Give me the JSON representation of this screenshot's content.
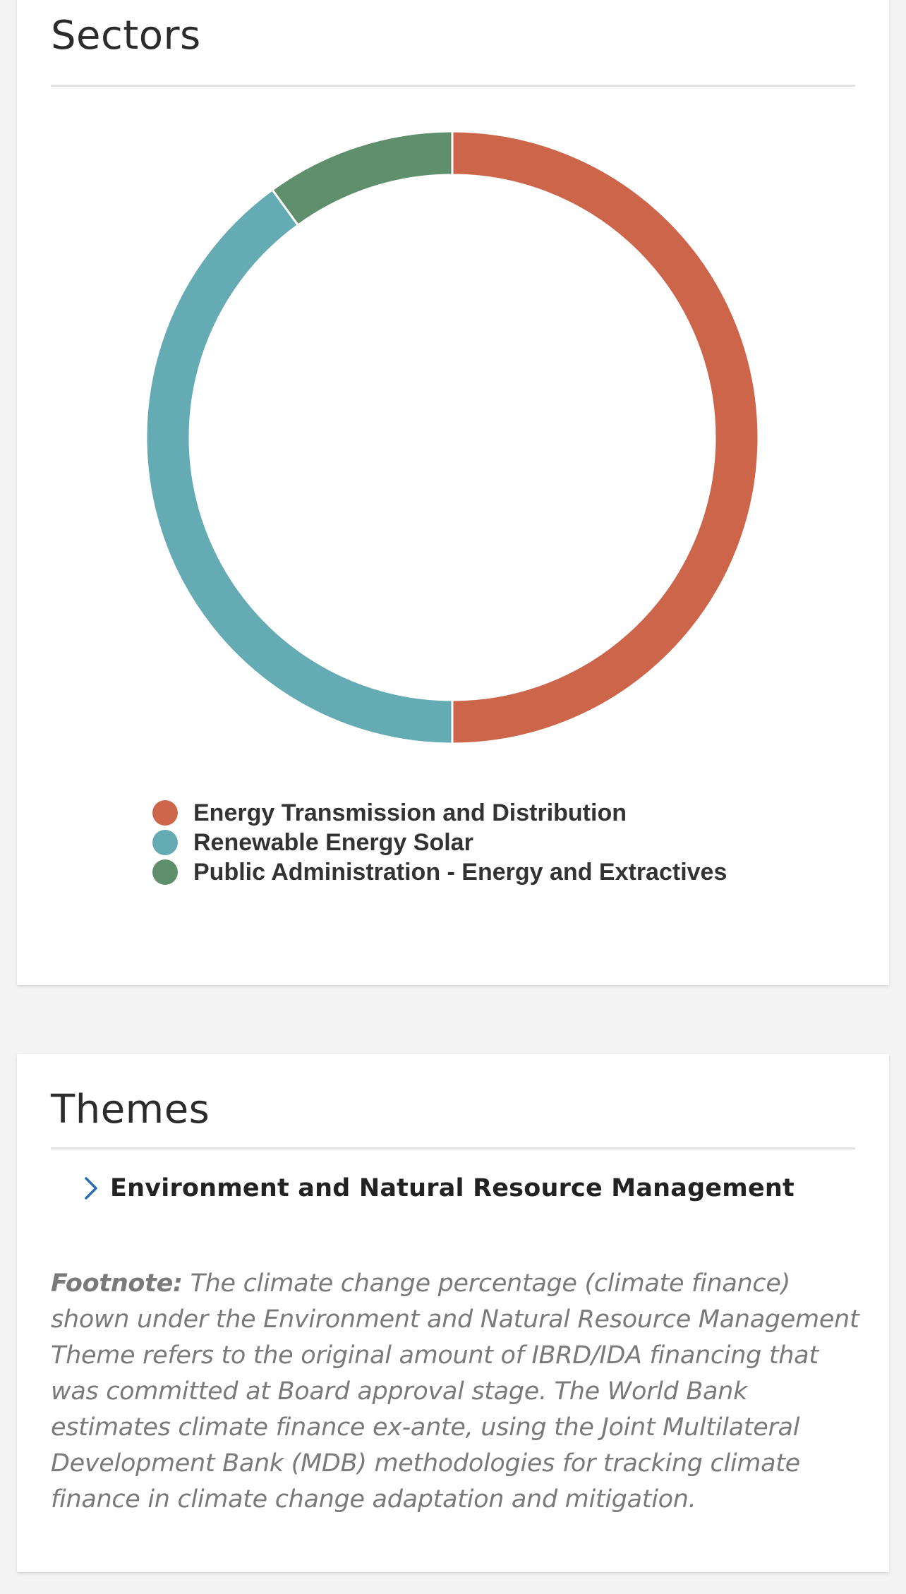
{
  "sectors": {
    "title": "Sectors"
  },
  "chart_data": {
    "type": "pie",
    "donut": true,
    "title": "Sectors",
    "categories": [
      "Energy Transmission and Distribution",
      "Renewable Energy Solar",
      "Public Administration - Energy and Extractives"
    ],
    "values": [
      50,
      40,
      10
    ],
    "unit": "%",
    "colors": [
      "#cd654b",
      "#64abb4",
      "#5f8f6c"
    ],
    "legend_position": "bottom"
  },
  "themes": {
    "title": "Themes",
    "items": [
      {
        "label": "Environment and Natural Resource Management",
        "icon": "chevron-right-icon"
      }
    ],
    "footnote": {
      "label": "Footnote:",
      "text": " The climate change percentage (climate finance) shown under the Environment and Natural Resource Management Theme refers to the original amount of IBRD/IDA financing that was committed at Board approval stage. The World Bank estimates climate finance ex-ante, using the Joint Multilateral Development Bank (MDB) methodologies for tracking climate finance in climate change adaptation and mitigation."
    }
  },
  "colors": {
    "background": "#f4f4f4",
    "card": "#ffffff",
    "accent_link": "#2a6db4"
  }
}
